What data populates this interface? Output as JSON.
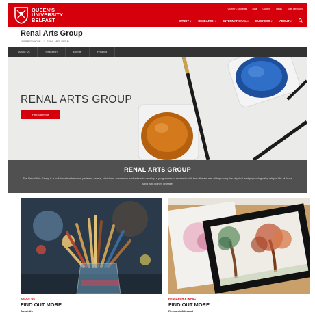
{
  "header": {
    "logo": {
      "line1": "QUEEN'S",
      "line2": "UNIVERSITY",
      "line3": "BELFAST"
    },
    "utility": [
      "Queen's Students",
      "Staff",
      "Current",
      "News",
      "Staff Directory"
    ],
    "nav": [
      "STUDY ▾",
      "RESEARCH ▾",
      "INTERNATIONAL ▾",
      "BUSINESS ▾",
      "ABOUT ▾"
    ],
    "brand_color": "#d6000d"
  },
  "site": {
    "title": "Renal Arts Group",
    "breadcrumb": [
      "University Home",
      "/",
      "Renal Arts Group"
    ]
  },
  "subnav": [
    "About Us",
    "Research",
    "Events",
    "Projects"
  ],
  "hero": {
    "title": "RENAL ARTS GROUP",
    "button": "Find out more"
  },
  "banner": {
    "title": "RENAL ARTS GROUP",
    "text": "The Renal Arts Group is a collaboration between patients, carers, clinicians, academics and artists to develop a programme of research with the ultimate aim of improving the physical and psychological quality of life of those living with kidney disease."
  },
  "cards": [
    {
      "tag": "About Us",
      "heading": "FIND OUT MORE",
      "link": "About Us ›"
    },
    {
      "tag": "Research & Impact",
      "heading": "FIND OUT MORE",
      "link": "Research & Impact ›"
    }
  ]
}
